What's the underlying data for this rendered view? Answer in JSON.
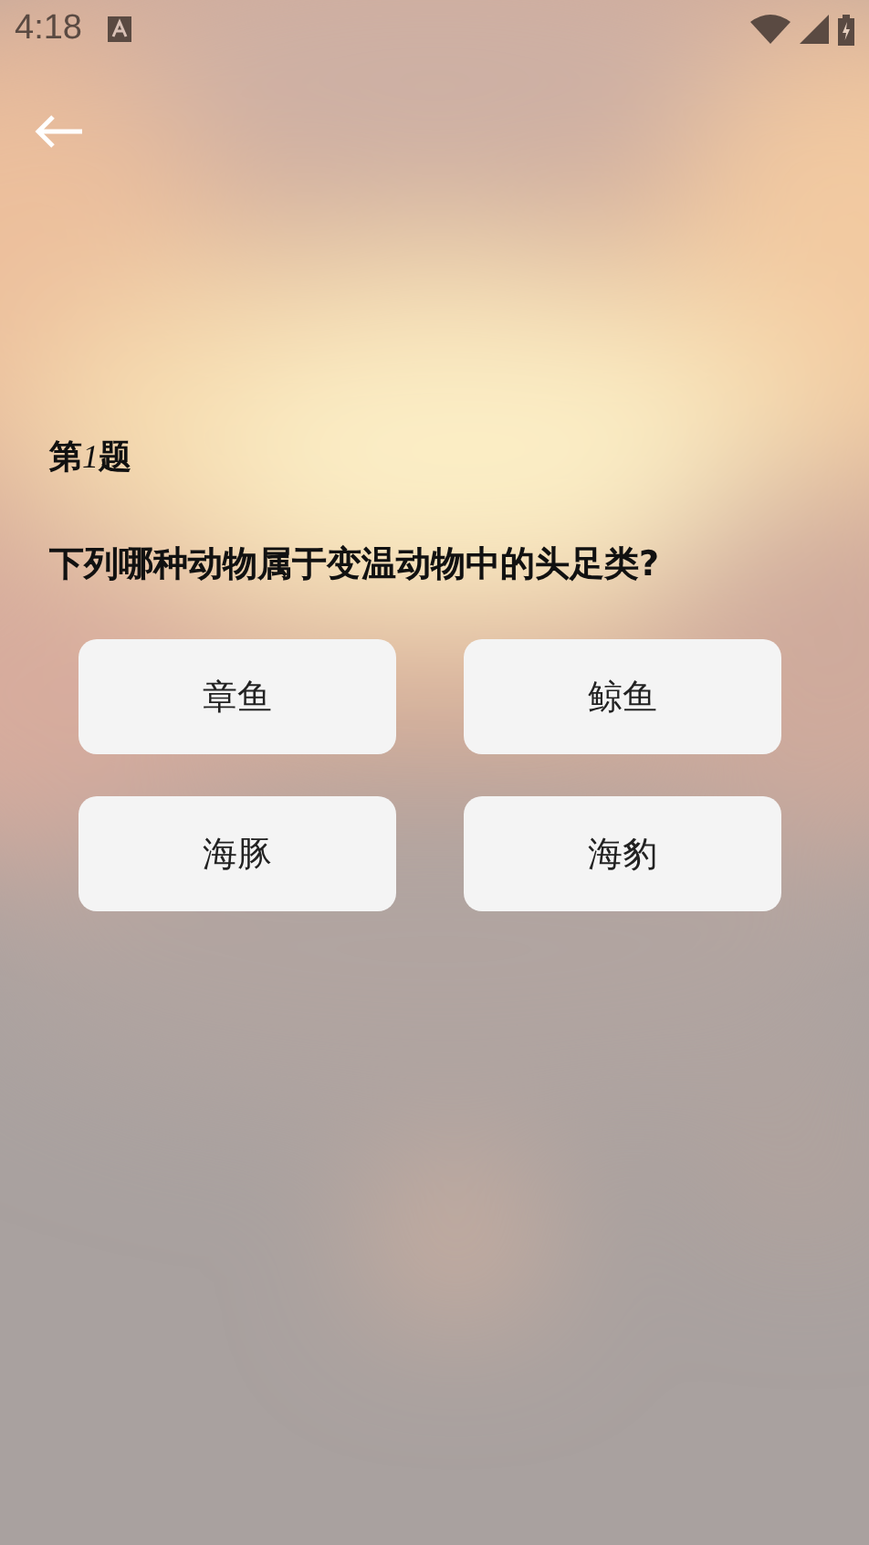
{
  "status_bar": {
    "time": "4:18"
  },
  "question": {
    "number_label": {
      "before": "第",
      "number": "1",
      "after": "题"
    },
    "text": "下列哪种动物属于变温动物中的头足类?"
  },
  "options": [
    {
      "label": "章鱼"
    },
    {
      "label": "鲸鱼"
    },
    {
      "label": "海豚"
    },
    {
      "label": "海豹"
    }
  ]
}
